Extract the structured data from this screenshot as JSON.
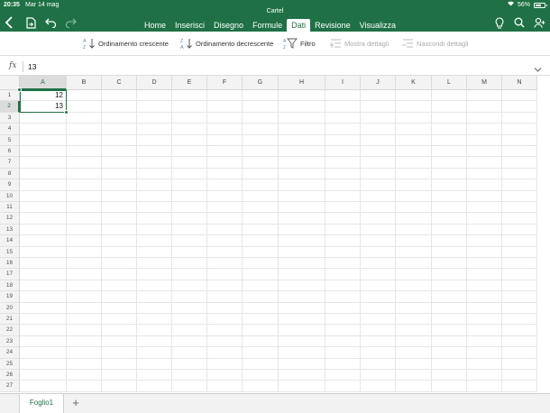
{
  "status": {
    "time": "20:35",
    "date": "Mar 14 mag",
    "battery": "56%"
  },
  "document": {
    "title": "Cartel"
  },
  "tabs": [
    {
      "label": "Home",
      "active": false
    },
    {
      "label": "Inserisci",
      "active": false
    },
    {
      "label": "Disegno",
      "active": false
    },
    {
      "label": "Formule",
      "active": false
    },
    {
      "label": "Dati",
      "active": true
    },
    {
      "label": "Revisione",
      "active": false
    },
    {
      "label": "Visualizza",
      "active": false
    }
  ],
  "ribbon": {
    "sort_asc": "Ordinamento crescente",
    "sort_desc": "Ordinamento decrescente",
    "filter": "Filtro",
    "show_details": "Mostra dettagli",
    "hide_details": "Nascondi dettagli"
  },
  "formula_bar": {
    "fx": "fx",
    "value": "13"
  },
  "grid": {
    "columns": [
      "A",
      "B",
      "C",
      "D",
      "E",
      "F",
      "G",
      "H",
      "I",
      "J",
      "K",
      "L",
      "M",
      "N"
    ],
    "row_count": 27,
    "selected_column": "A",
    "selected_row": 2,
    "cells": [
      {
        "ref": "A1",
        "value": "12"
      },
      {
        "ref": "A2",
        "value": "13"
      }
    ]
  },
  "sheets": {
    "tabs": [
      "Foglio1"
    ],
    "add": "+"
  },
  "colors": {
    "accent": "#1f7145"
  }
}
